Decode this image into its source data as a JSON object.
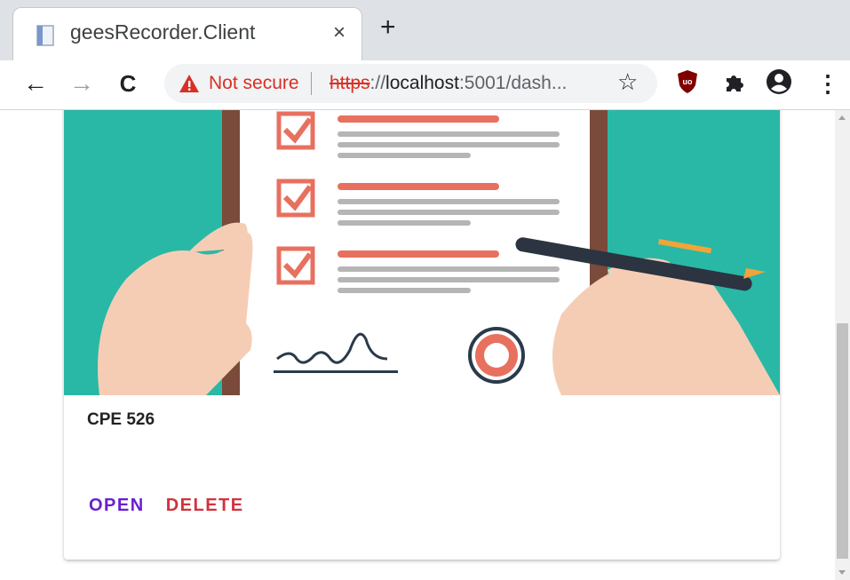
{
  "tab": {
    "title": "geesRecorder.Client",
    "close_glyph": "×",
    "favicon": "page-icon"
  },
  "new_tab_glyph": "+",
  "toolbar": {
    "back_glyph": "←",
    "forward_glyph": "→",
    "reload_glyph": "C",
    "security_label": "Not secure",
    "url_scheme": "https",
    "url_sep": "://",
    "url_host": "localhost",
    "url_rest": ":5001/dash...",
    "star_glyph": "☆",
    "menu_glyph": "⋮"
  },
  "card": {
    "title": "CPE 526",
    "open_label": "OPEN",
    "delete_label": "DELETE"
  },
  "colors": {
    "teal": "#29b8a5",
    "accent_open": "#6a1fd0",
    "accent_delete": "#d2323e",
    "warning_red": "#d93025"
  }
}
